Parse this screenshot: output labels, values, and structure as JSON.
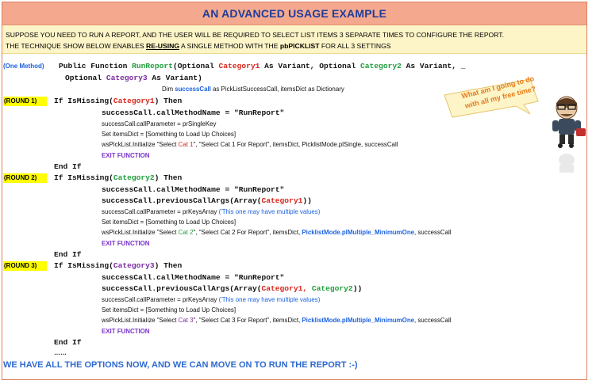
{
  "title": "AN ADVANCED USAGE EXAMPLE",
  "intro": {
    "line1": "SUPPOSE YOU NEED TO RUN A REPORT, AND THE USER WILL BE REQUIRED TO SELECT LIST ITEMS 3 SEPARATE TIMES TO CONFIGURE THE REPORT.",
    "line2_a": "THE TECHNIQUE SHOW BELOW ENABLES ",
    "line2_b": "RE-USING",
    "line2_c": " A SINGLE METHOD WITH THE ",
    "line2_d": "pbPICKLIST",
    "line2_e": " FOR ALL 3 SETTINGS"
  },
  "labels": {
    "one_method": "(One Method)",
    "round1": "(ROUND 1)",
    "round2": "(ROUND 2)",
    "round3": "(ROUND 3)"
  },
  "code": {
    "sig1_a": "Public Function ",
    "sig1_fn": "RunReport",
    "sig1_b": "(Optional ",
    "sig1_c1": "Category1",
    "sig1_c": " As Variant, Optional ",
    "sig1_c2": "Category2",
    "sig1_d": " As Variant, _",
    "sig2_a": "Optional ",
    "sig2_c3": "Category3",
    "sig2_b": " As Variant)",
    "dim_a": "Dim ",
    "dim_b": "successCall",
    "dim_c": " as PickListSuccessCall, itemsDict as Dictionary",
    "if_a": "If IsMissing(",
    "if_b": ") Then",
    "cat1": "Category1",
    "cat2": "Category2",
    "cat3": "Category3",
    "method_name": "successCall.callMethodName = \"RunReport\"",
    "prev_a": "successCall.previousCallArgs(Array(",
    "prev_b": "))",
    "prev_sep": ", ",
    "param_single": "successCall.callParameter = prSingleKey",
    "param_keys": "successCall.callParameter = prKeysArray ",
    "param_comment": "('This one may have multiple values)",
    "set_items": "Set itemsDict = [Something to Load Up Choices]",
    "init_a": "wsPickList.Initialize \"Select ",
    "cat1_short": "Cat 1",
    "cat2_short": "Cat 2",
    "cat3_short": "Cat 3",
    "init1_b": "\", \"Select Cat 1 For Report\", itemsDict, PicklistMode.plSingle, successCall",
    "init2_b": "\", \"Select Cat 2 For Report\", itemsDict, ",
    "init3_b": "\", \"Select Cat 3 For Report\", itemsDict, ",
    "mode_multi": "PicklistMode.plMultiple_MinimumOne",
    "init_end": ", successCall",
    "exit_fn": "EXIT FUNCTION",
    "end_if": "End If",
    "ellipsis": "……"
  },
  "bubble": "What am I going to do with all my free time?",
  "footer": "WE HAVE ALL THE OPTIONS NOW, AND WE CAN MOVE ON TO RUN THE REPORT :-)"
}
